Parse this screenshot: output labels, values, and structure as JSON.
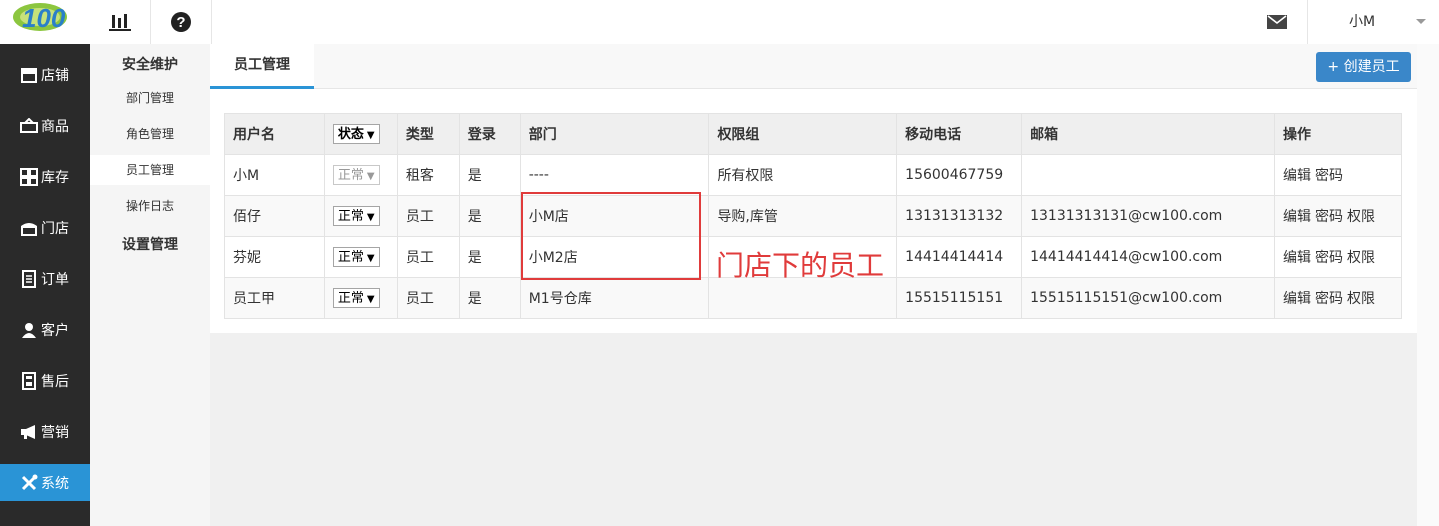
{
  "header": {
    "logo_label": "100",
    "user_name": "小M"
  },
  "sidebar": {
    "items": [
      {
        "label": "店铺",
        "icon": "store-icon"
      },
      {
        "label": "商品",
        "icon": "goods-icon"
      },
      {
        "label": "库存",
        "icon": "inventory-icon"
      },
      {
        "label": "门店",
        "icon": "shop-icon"
      },
      {
        "label": "订单",
        "icon": "order-icon"
      },
      {
        "label": "客户",
        "icon": "customer-icon"
      },
      {
        "label": "售后",
        "icon": "aftersale-icon"
      },
      {
        "label": "营销",
        "icon": "marketing-icon"
      },
      {
        "label": "系统",
        "icon": "system-icon"
      }
    ],
    "active": "系统",
    "active_color": "#2a94d6"
  },
  "subnav": {
    "group1": "安全维护",
    "items": [
      "部门管理",
      "角色管理",
      "员工管理",
      "操作日志"
    ],
    "group2": "设置管理"
  },
  "tabs": {
    "active": "员工管理"
  },
  "create_button": "+ 创建员工",
  "table": {
    "headers": [
      "用户名",
      "状态",
      "类型",
      "登录",
      "部门",
      "权限组",
      "移动电话",
      "邮箱",
      "操作"
    ],
    "rows": [
      {
        "username": "小M",
        "status": "正常",
        "status_disabled": true,
        "type": "租客",
        "login": "是",
        "dept": "----",
        "perm": "所有权限",
        "phone": "15600467759",
        "email": "",
        "ops": [
          "编辑",
          "密码"
        ]
      },
      {
        "username": "佰仔",
        "status": "正常",
        "status_disabled": false,
        "type": "员工",
        "login": "是",
        "dept": "小M店",
        "perm": "导购,库管",
        "phone": "13131313132",
        "email": "13131313131@cw100.com",
        "ops": [
          "编辑",
          "密码",
          "权限"
        ]
      },
      {
        "username": "芬妮",
        "status": "正常",
        "status_disabled": false,
        "type": "员工",
        "login": "是",
        "dept": "小M2店",
        "perm": "",
        "phone": "14414414414",
        "email": "14414414414@cw100.com",
        "ops": [
          "编辑",
          "密码",
          "权限"
        ]
      },
      {
        "username": "员工甲",
        "status": "正常",
        "status_disabled": false,
        "type": "员工",
        "login": "是",
        "dept": "M1号仓库",
        "perm": "",
        "phone": "15515115151",
        "email": "15515115151@cw100.com",
        "ops": [
          "编辑",
          "密码",
          "权限"
        ]
      }
    ]
  },
  "annotation": {
    "text": "门店下的员工",
    "color": "#e03b3b"
  }
}
